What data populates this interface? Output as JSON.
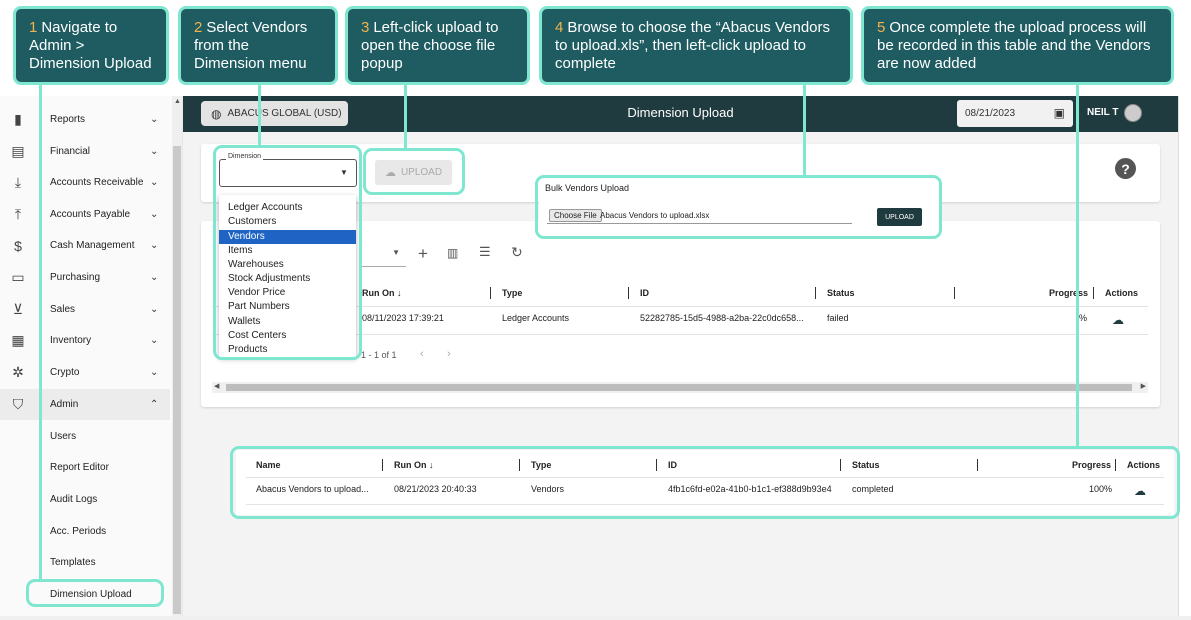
{
  "callouts": [
    {
      "num": "1",
      "text": "Navigate to Admin > Dimension Upload"
    },
    {
      "num": "2",
      "text": "Select Vendors from the Dimension menu"
    },
    {
      "num": "3",
      "text": "Left-click upload to open the choose file popup"
    },
    {
      "num": "4",
      "text": "Browse to choose the “Abacus Vendors to upload.xls”, then left-click upload to complete"
    },
    {
      "num": "5",
      "text": "Once complete the upload process will be recorded in this table and the Vendors are now added"
    }
  ],
  "header": {
    "entity": "ABACUS GLOBAL (USD)",
    "title": "Dimension Upload",
    "date": "08/21/2023",
    "user": "NEIL T"
  },
  "sidebar": {
    "items": [
      {
        "label": "Reports",
        "icon": "bar-chart-icon"
      },
      {
        "label": "Financial",
        "icon": "clipboard-icon"
      },
      {
        "label": "Accounts Receivable",
        "icon": "download-icon"
      },
      {
        "label": "Accounts Payable",
        "icon": "upload-icon"
      },
      {
        "label": "Cash Management",
        "icon": "dollar-icon"
      },
      {
        "label": "Purchasing",
        "icon": "credit-card-icon"
      },
      {
        "label": "Sales",
        "icon": "cart-icon"
      },
      {
        "label": "Inventory",
        "icon": "grid-icon"
      },
      {
        "label": "Crypto",
        "icon": "network-icon"
      },
      {
        "label": "Admin",
        "icon": "shield-gear-icon"
      }
    ],
    "admin_sub": [
      "Users",
      "Report Editor",
      "Audit Logs",
      "Acc. Periods",
      "Templates",
      "Dimension Upload"
    ]
  },
  "dimension": {
    "label": "Dimension",
    "upload_label": "UPLOAD",
    "options": [
      "Ledger Accounts",
      "Customers",
      "Vendors",
      "Items",
      "Warehouses",
      "Stock Adjustments",
      "Vendor Price",
      "Part Numbers",
      "Wallets",
      "Cost Centers",
      "Products"
    ],
    "selected": "Vendors"
  },
  "bulk": {
    "title": "Bulk Vendors Upload",
    "choose_label": "Choose File",
    "file_name": "Abacus Vendors to upload.xlsx",
    "upload_label": "UPLOAD"
  },
  "table": {
    "columns": [
      "Run On ↓",
      "Type",
      "ID",
      "Status",
      "Progress",
      "Actions"
    ],
    "row": {
      "run_on": "08/11/2023 17:39:21",
      "type": "Ledger Accounts",
      "id": "52282785-15d5-4988-a2ba-22c0dc658...",
      "status": "failed",
      "progress": "%"
    },
    "pager": "1 - 1 of 1"
  },
  "result": {
    "columns": [
      "Name",
      "Run On ↓",
      "Type",
      "ID",
      "Status",
      "Progress",
      "Actions"
    ],
    "row": {
      "name": "Abacus Vendors to upload...",
      "run_on": "08/21/2023 20:40:33",
      "type": "Vendors",
      "id": "4fb1c6fd-e02a-41b0-b1c1-ef388d9b93e4",
      "status": "completed",
      "progress": "100%"
    }
  },
  "colors": {
    "header": "#1f3b40",
    "callout": "#1e5c62",
    "highlight": "#7fe6d0",
    "number": "#f4b24a",
    "selected": "#1f64c4"
  }
}
